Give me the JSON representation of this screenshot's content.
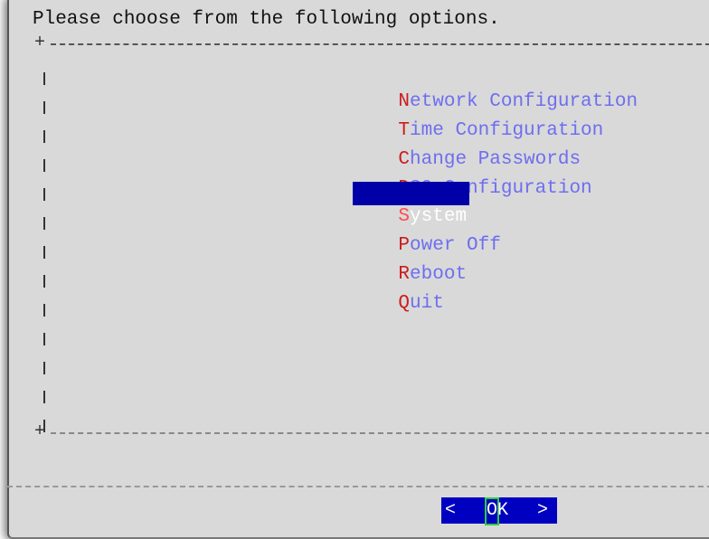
{
  "dialog": {
    "prompt": "Please choose from the following options.",
    "menu": [
      {
        "hotkey": "N",
        "rest": "etwork Configuration",
        "selected": false
      },
      {
        "hotkey": "T",
        "rest": "ime Configuration",
        "selected": false
      },
      {
        "hotkey": "C",
        "rest": "hange Passwords",
        "selected": false
      },
      {
        "hotkey": "D",
        "rest": "S9 Configuration",
        "selected": false
      },
      {
        "hotkey": "S",
        "rest": "ystem",
        "selected": true
      },
      {
        "hotkey": "P",
        "rest": "ower Off",
        "selected": false
      },
      {
        "hotkey": "R",
        "rest": "eboot",
        "selected": false
      },
      {
        "hotkey": "Q",
        "rest": "uit",
        "selected": false
      }
    ],
    "ok_button": {
      "left": "<",
      "label": "OK",
      "right": ">"
    },
    "colors": {
      "hotkey": "#cc1d1d",
      "item_text": "#6e6ef0",
      "selection_bg": "#0000a8",
      "button_bg": "#0000c0",
      "focus_cursor": "#2ecc40",
      "dialog_bg": "#d9d9d9"
    }
  }
}
